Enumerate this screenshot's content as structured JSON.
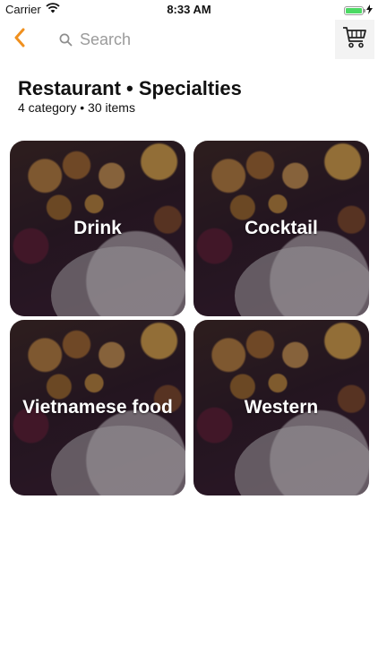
{
  "status_bar": {
    "carrier": "Carrier",
    "time": "8:33 AM",
    "battery_level": 1.0,
    "battery_color": "#4cd964"
  },
  "nav": {
    "back_icon": "chevron-left-icon",
    "accent_color": "#f0901e",
    "search": {
      "placeholder": "Search",
      "value": ""
    },
    "cart_icon": "cart-icon"
  },
  "header": {
    "title": "Restaurant • Specialties",
    "subtitle": "4 category • 30 items"
  },
  "categories": [
    {
      "label": "Drink"
    },
    {
      "label": "Cocktail"
    },
    {
      "label": "Vietnamese food"
    },
    {
      "label": "Western"
    }
  ]
}
